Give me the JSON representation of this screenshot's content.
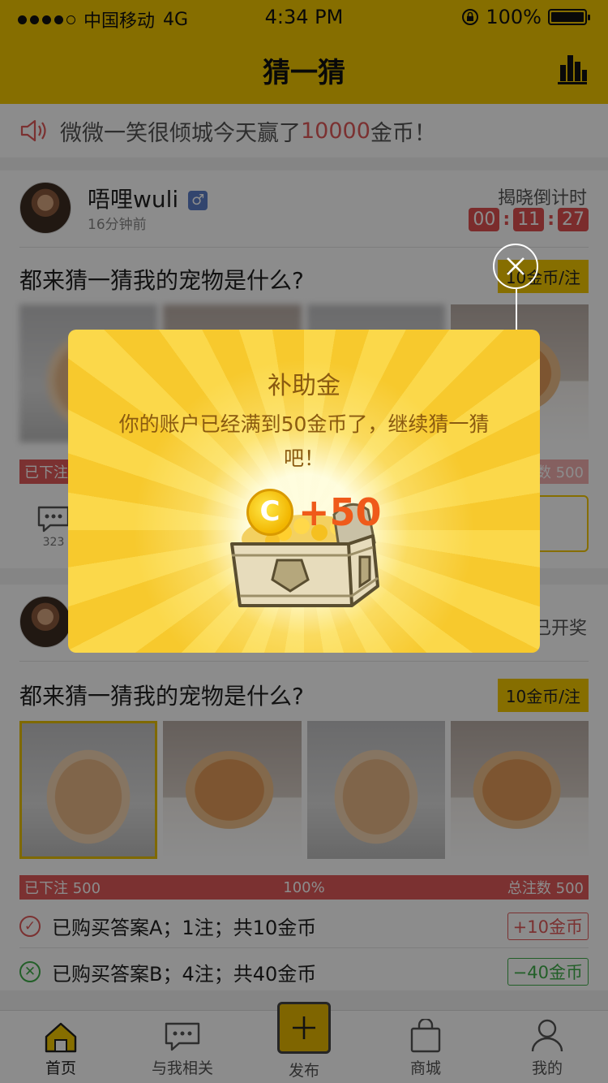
{
  "status_bar": {
    "carrier": "中国移动",
    "network": "4G",
    "time": "4:34 PM",
    "battery": "100%"
  },
  "header": {
    "title": "猜一猜"
  },
  "notice": {
    "user": "微微一笑很倾城",
    "text_mid": "今天赢了",
    "amount": "10000",
    "text_end": "金币！"
  },
  "card1": {
    "username": "唔哩wuli",
    "gender": "♂",
    "post_time": "16分钟前",
    "countdown_label": "揭晓倒计时",
    "countdown": [
      "00",
      "11",
      "27"
    ],
    "question": "都来猜一猜我的宠物是什么?",
    "price": "10金币/注",
    "bet_left": "已下注",
    "total_right": "数 500",
    "comment_count": "323"
  },
  "card2": {
    "status": "已开奖",
    "question": "都来猜一猜我的宠物是什么?",
    "price": "10金币/注",
    "progress": {
      "left": "已下注 500",
      "mid": "100%",
      "right": "总注数 500"
    },
    "purchases": [
      {
        "text": "已购买答案A；1注；共10金币",
        "delta": "+10金币"
      },
      {
        "text": "已购买答案B；4注；共40金币",
        "delta": "−40金币"
      }
    ]
  },
  "tabs": [
    {
      "label": "首页",
      "icon": "home-icon"
    },
    {
      "label": "与我相关",
      "icon": "chat-icon"
    },
    {
      "label": "发布",
      "icon": "plus-icon"
    },
    {
      "label": "商城",
      "icon": "bag-icon"
    },
    {
      "label": "我的",
      "icon": "person-icon"
    }
  ],
  "modal": {
    "title": "补助金",
    "message": "你的账户已经满到50金币了，继续猜一猜吧！",
    "reward": "+50",
    "coin_symbol": "C"
  },
  "colors": {
    "brand_yellow": "#f5c800",
    "alert_red": "#e05a5a",
    "success_green": "#3fae4a",
    "modal_text": "#8a5a10",
    "reward_orange": "#ef5a1a"
  }
}
